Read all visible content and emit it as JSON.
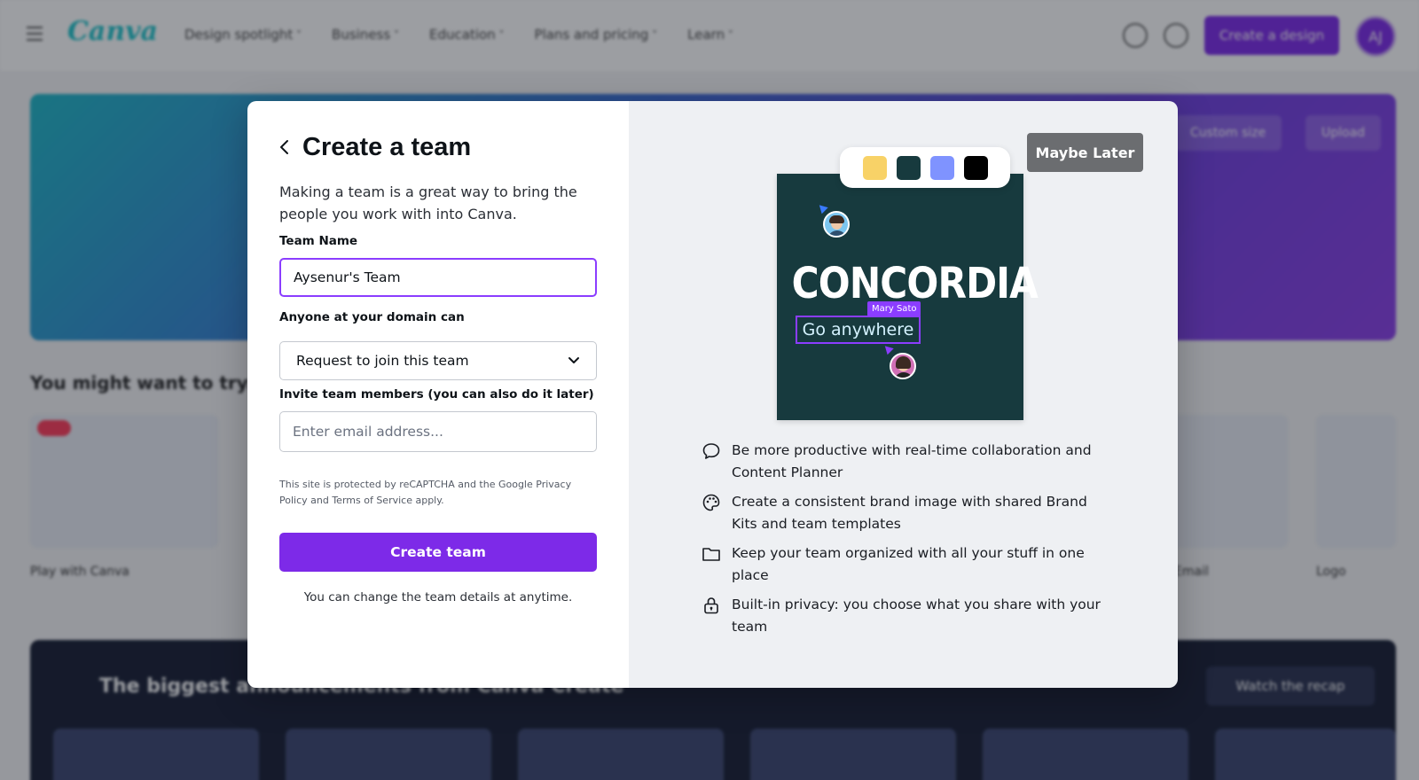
{
  "background": {
    "topbar": {
      "logo": "Canva",
      "nav": [
        "Design spotlight",
        "Business",
        "Education",
        "Plans and pricing",
        "Learn"
      ],
      "create_button": "Create a design",
      "avatar_initials": "AJ"
    },
    "hero": {
      "buttons": [
        "Custom size",
        "Upload"
      ]
    },
    "section_title": "You might want to try...",
    "cards": [
      {
        "label": "Play with Canva"
      },
      {
        "label": "Email"
      },
      {
        "label": "Logo"
      }
    ],
    "dark_section": {
      "title": "The biggest announcements from Canva Create",
      "button": "Watch the recap"
    }
  },
  "modal": {
    "title": "Create a team",
    "description": "Making a team is a great way to bring the people you work with into Canva.",
    "team_name": {
      "label": "Team Name",
      "value": "Aysenur's Team"
    },
    "domain": {
      "label": "Anyone at your domain can",
      "selected": "Request to join this team"
    },
    "invite": {
      "label": "Invite team members (you can also do it later)",
      "placeholder": "Enter email address..."
    },
    "fine_print": "This site is protected by reCAPTCHA and the Google Privacy Policy and Terms of Service apply.",
    "cta": "Create team",
    "note": "You can change the team details at anytime.",
    "maybe_later": "Maybe Later",
    "preview": {
      "swatches": [
        "#f8d267",
        "#173a3e",
        "#7f93ff",
        "#000000"
      ],
      "brand_text": "CONCORDIA",
      "tagline": "Go anywhere",
      "collaborator": "Mary Sato"
    },
    "features": [
      {
        "icon": "chat-bubble-icon",
        "text": "Be more productive with real-time collaboration and Content Planner"
      },
      {
        "icon": "palette-icon",
        "text": "Create a consistent brand image with shared Brand Kits and team templates"
      },
      {
        "icon": "folder-icon",
        "text": "Keep your team organized with all your stuff in one place"
      },
      {
        "icon": "lock-icon",
        "text": "Built-in privacy: you choose what you share with your team"
      }
    ]
  },
  "colors": {
    "accent": "#7d2ae8",
    "focus": "#8b3dff",
    "maybe_later_bg": "#6b6d70",
    "panel_right": "#eef0f3"
  }
}
